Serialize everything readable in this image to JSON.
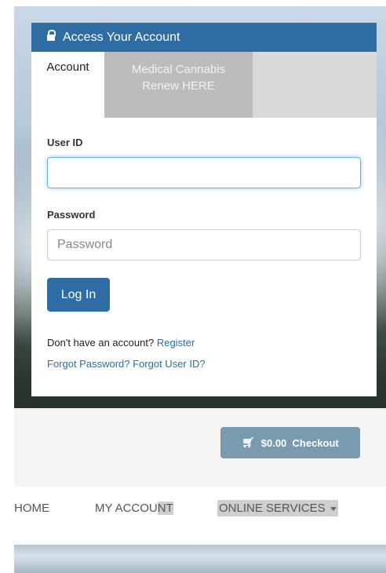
{
  "login_panel": {
    "header_title": "Access Your Account",
    "tabs": [
      {
        "label": "Account"
      },
      {
        "label_line1": "Medical Cannabis",
        "label_line2": "Renew HERE"
      }
    ],
    "user_id_label": "User ID",
    "user_id_value": "",
    "password_label": "Password",
    "password_placeholder": "Password",
    "login_button": "Log In",
    "no_account_text": "Don't have an account?",
    "register_link": "Register",
    "forgot_password_link": "Forgot Password?",
    "forgot_userid_link": "Forgot User ID?"
  },
  "cart": {
    "amount": "$0.00",
    "checkout_label": "Checkout",
    "icon": "cart-icon"
  },
  "nav": {
    "items": [
      {
        "label": "HOME"
      },
      {
        "label_a": "MY ACCOU",
        "label_b": "NT"
      },
      {
        "label": "ONLINE SERVICES"
      }
    ]
  },
  "colors": {
    "primary": "#2e6da4",
    "tab_inactive": "#bcbcbc",
    "checkout_button": "#7a9ab0"
  }
}
